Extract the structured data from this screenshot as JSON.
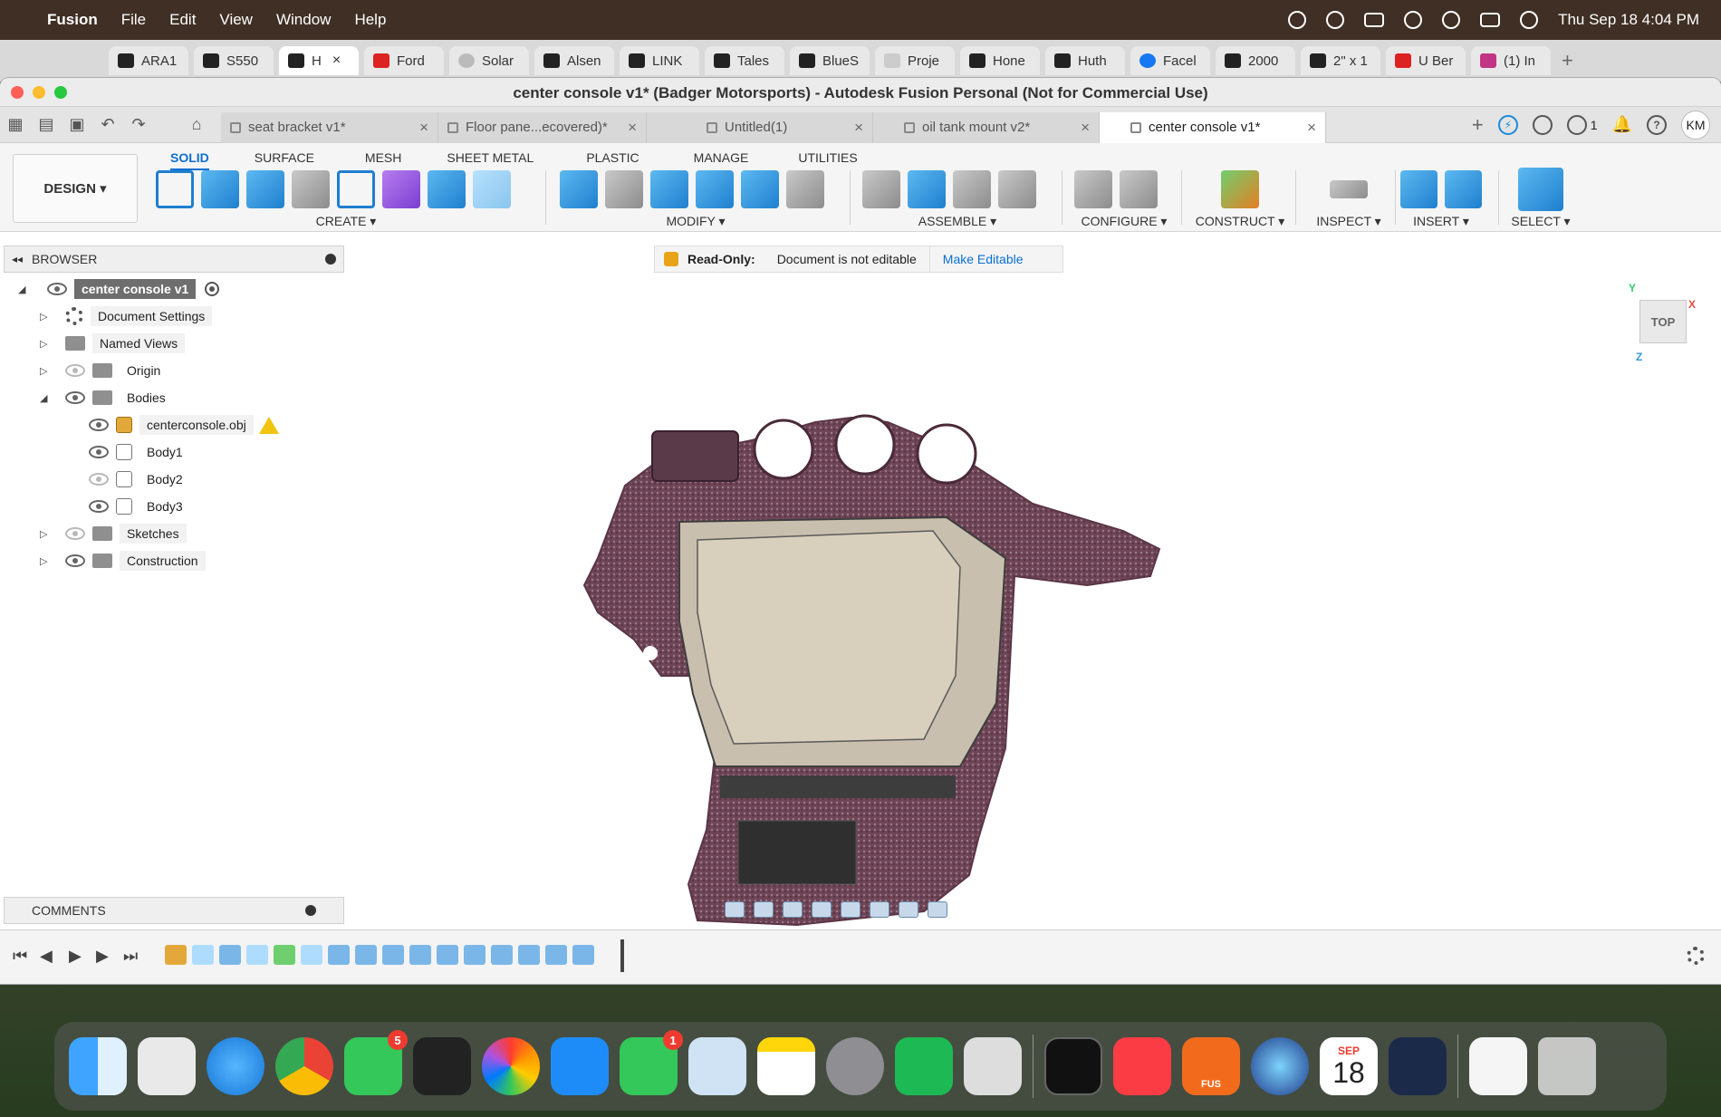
{
  "menubar": {
    "app": "Fusion",
    "items": [
      "File",
      "Edit",
      "View",
      "Window",
      "Help"
    ],
    "clock": "Thu Sep 18  4:04 PM"
  },
  "browser_tabs": [
    {
      "label": "ARA1"
    },
    {
      "label": "S550"
    },
    {
      "label": "H",
      "active": true
    },
    {
      "label": "Ford"
    },
    {
      "label": "Solar"
    },
    {
      "label": "Alsen"
    },
    {
      "label": "LINK"
    },
    {
      "label": "Tales"
    },
    {
      "label": "BlueS"
    },
    {
      "label": "Proje"
    },
    {
      "label": "Hone"
    },
    {
      "label": "Huth"
    },
    {
      "label": "Facel"
    },
    {
      "label": "2000"
    },
    {
      "label": "2\" x 1"
    },
    {
      "label": "U Ber"
    },
    {
      "label": "(1) In"
    }
  ],
  "window": {
    "title": "center console v1* (Badger Motorsports) - Autodesk Fusion Personal (Not for Commercial Use)"
  },
  "doc_tabs": [
    {
      "label": "seat bracket v1*"
    },
    {
      "label": "Floor pane...ecovered)*"
    },
    {
      "label": "Untitled(1)"
    },
    {
      "label": "oil tank mount v2*"
    },
    {
      "label": "center console v1*",
      "active": true
    }
  ],
  "doc_right": {
    "jobs_count": "1",
    "user_initials": "KM"
  },
  "ribbon": {
    "workspace": "DESIGN ▾",
    "tabs": [
      "SOLID",
      "SURFACE",
      "MESH",
      "SHEET METAL",
      "PLASTIC",
      "MANAGE",
      "UTILITIES"
    ],
    "groups": {
      "create": "CREATE ▾",
      "modify": "MODIFY ▾",
      "assemble": "ASSEMBLE ▾",
      "configure": "CONFIGURE ▾",
      "construct": "CONSTRUCT ▾",
      "inspect": "INSPECT ▾",
      "insert": "INSERT ▾",
      "select": "SELECT ▾"
    }
  },
  "browser_panel": {
    "header": "BROWSER",
    "root": "center console v1",
    "items": {
      "doc_settings": "Document Settings",
      "named_views": "Named Views",
      "origin": "Origin",
      "bodies": "Bodies",
      "obj": "centerconsole.obj",
      "body1": "Body1",
      "body2": "Body2",
      "body3": "Body3",
      "sketches": "Sketches",
      "construction": "Construction"
    }
  },
  "readonly_bar": {
    "label": "Read-Only:",
    "message": "Document is not editable",
    "action": "Make Editable"
  },
  "viewcube": {
    "face": "TOP",
    "axis_x": "X",
    "axis_y": "Y",
    "axis_z": "Z"
  },
  "comments": {
    "label": "COMMENTS"
  },
  "dock": {
    "messages_badge": "5",
    "facetime_badge": "1",
    "cal_month": "SEP",
    "cal_day": "18",
    "fusion_label": "FUS"
  }
}
